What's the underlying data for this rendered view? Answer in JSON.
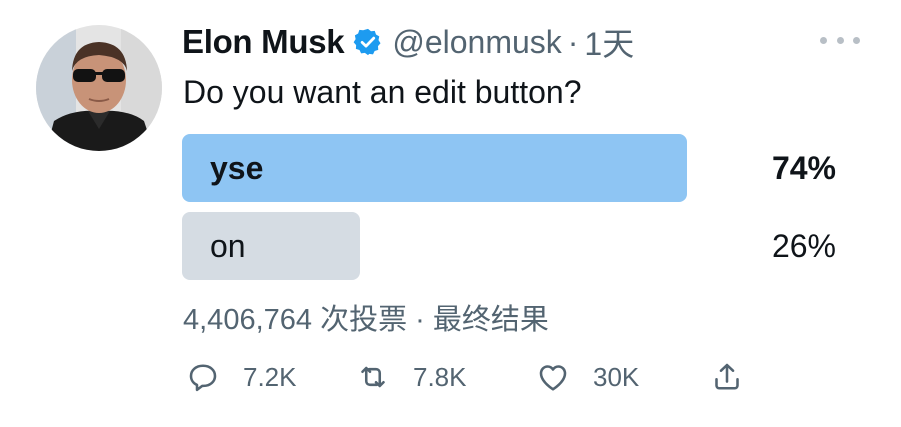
{
  "tweet": {
    "author_name": "Elon Musk",
    "handle": "@elonmusk",
    "separator": "·",
    "timestamp": "1天",
    "text": "Do you want an edit button?",
    "poll": {
      "options": [
        {
          "label": "yse",
          "percent_text": "74%",
          "percent": 74,
          "winner": true,
          "color": "#8ec5f3"
        },
        {
          "label": "on",
          "percent_text": "26%",
          "percent": 26,
          "winner": false,
          "color": "#d5dce3"
        }
      ],
      "votes": "4,406,764 次投票",
      "meta_separator": "·",
      "status": "最终结果"
    },
    "actions": {
      "reply_count": "7.2K",
      "retweet_count": "7.8K",
      "like_count": "30K"
    },
    "colors": {
      "verified": "#1d9bf0",
      "secondary_text": "#536471"
    }
  }
}
